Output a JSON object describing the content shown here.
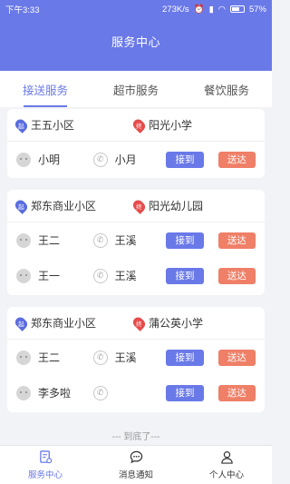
{
  "status_bar": {
    "time": "下午3:33",
    "network_speed": "273K/s",
    "battery": "57%"
  },
  "header": {
    "title": "服务中心"
  },
  "tabs": [
    {
      "label": "接送服务",
      "active": true
    },
    {
      "label": "超市服务",
      "active": false
    },
    {
      "label": "餐饮服务",
      "active": false
    }
  ],
  "pins": {
    "start": "起",
    "end": "终"
  },
  "actions": {
    "pickup": "接到",
    "deliver": "送达"
  },
  "cards": [
    {
      "from": "王五小区",
      "to": "阳光小学",
      "rows": [
        {
          "child": "小明",
          "parent": "小月"
        }
      ]
    },
    {
      "from": "郑东商业小区",
      "to": "阳光幼儿园",
      "rows": [
        {
          "child": "王二",
          "parent": "王溪"
        },
        {
          "child": "王一",
          "parent": "王溪"
        }
      ]
    },
    {
      "from": "郑东商业小区",
      "to": "蒲公英小学",
      "rows": [
        {
          "child": "王二",
          "parent": "王溪"
        },
        {
          "child": "李多啦",
          "parent": ""
        }
      ]
    }
  ],
  "end_text": "--- 到底了---",
  "bottom_nav": [
    {
      "label": "服务中心",
      "icon": "service-center-icon",
      "active": true
    },
    {
      "label": "消息通知",
      "icon": "message-icon",
      "active": false
    },
    {
      "label": "个人中心",
      "icon": "profile-icon",
      "active": false
    }
  ],
  "colors": {
    "primary": "#6a79e8",
    "deliver": "#ef7f67",
    "start_pin": "#5a6ce0",
    "end_pin": "#e64b4b"
  }
}
